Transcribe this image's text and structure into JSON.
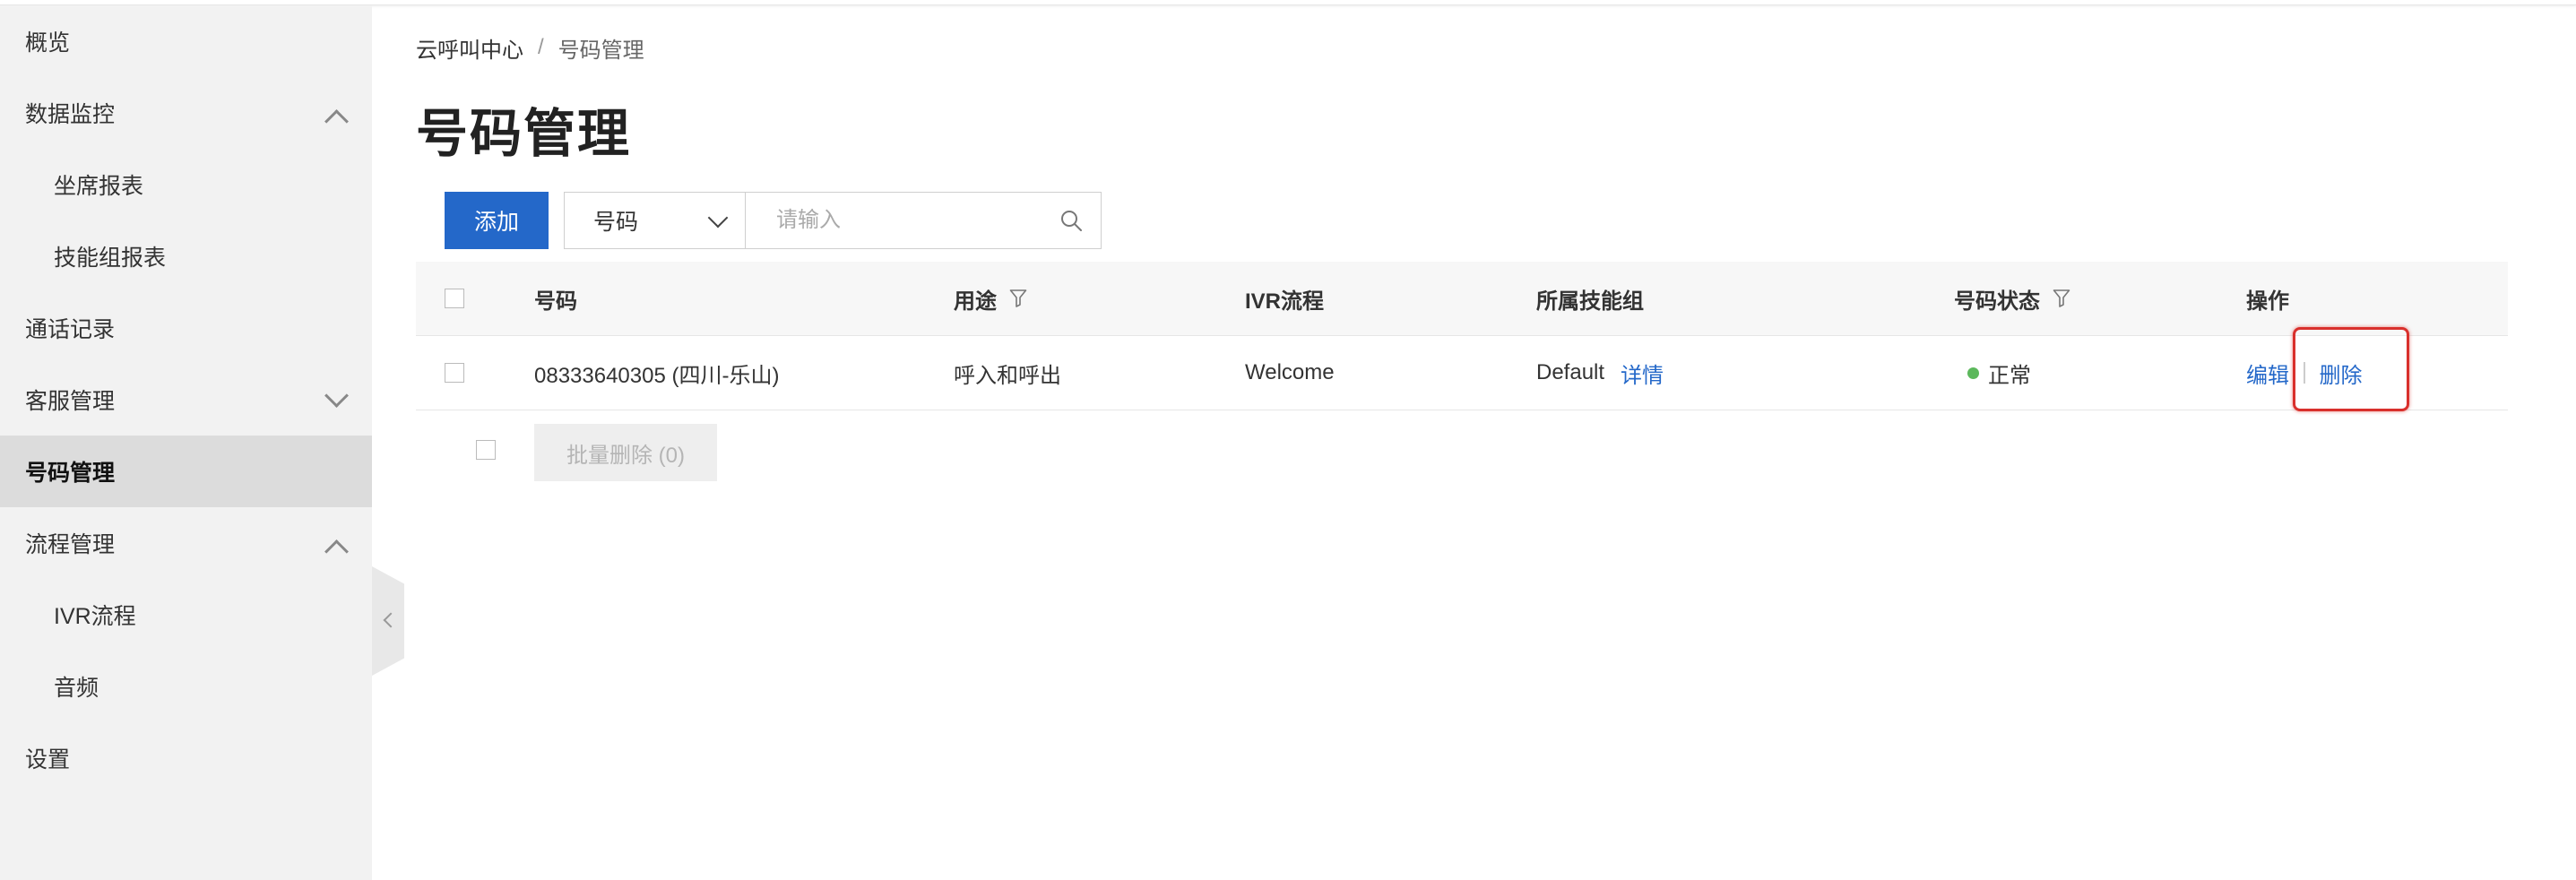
{
  "sidebar": {
    "items": [
      {
        "label": "概览"
      },
      {
        "label": "数据监控"
      },
      {
        "label": "坐席报表"
      },
      {
        "label": "技能组报表"
      },
      {
        "label": "通话记录"
      },
      {
        "label": "客服管理"
      },
      {
        "label": "号码管理"
      },
      {
        "label": "流程管理"
      },
      {
        "label": "IVR流程"
      },
      {
        "label": "音频"
      },
      {
        "label": "设置"
      }
    ]
  },
  "breadcrumb": {
    "root": "云呼叫中心",
    "separator": "/",
    "current": "号码管理"
  },
  "page_title": "号码管理",
  "toolbar": {
    "add_label": "添加",
    "select_value": "号码",
    "search_placeholder": "请输入"
  },
  "table": {
    "headers": {
      "number": "号码",
      "usage": "用途",
      "ivr": "IVR流程",
      "skill_group": "所属技能组",
      "status": "号码状态",
      "actions": "操作"
    },
    "rows": [
      {
        "number": "08333640305 (四川-乐山)",
        "usage": "呼入和呼出",
        "ivr": "Welcome",
        "skill_group": "Default",
        "detail_link": "详情",
        "status": "正常",
        "edit": "编辑",
        "delete": "删除"
      }
    ]
  },
  "batch_delete_label": "批量删除 (0)",
  "colors": {
    "primary": "#2468c9",
    "status_ok": "#5cb85c",
    "highlight": "#d9302c",
    "sidebar_bg": "#f2f2f2",
    "sidebar_active": "#dcdcdc"
  }
}
